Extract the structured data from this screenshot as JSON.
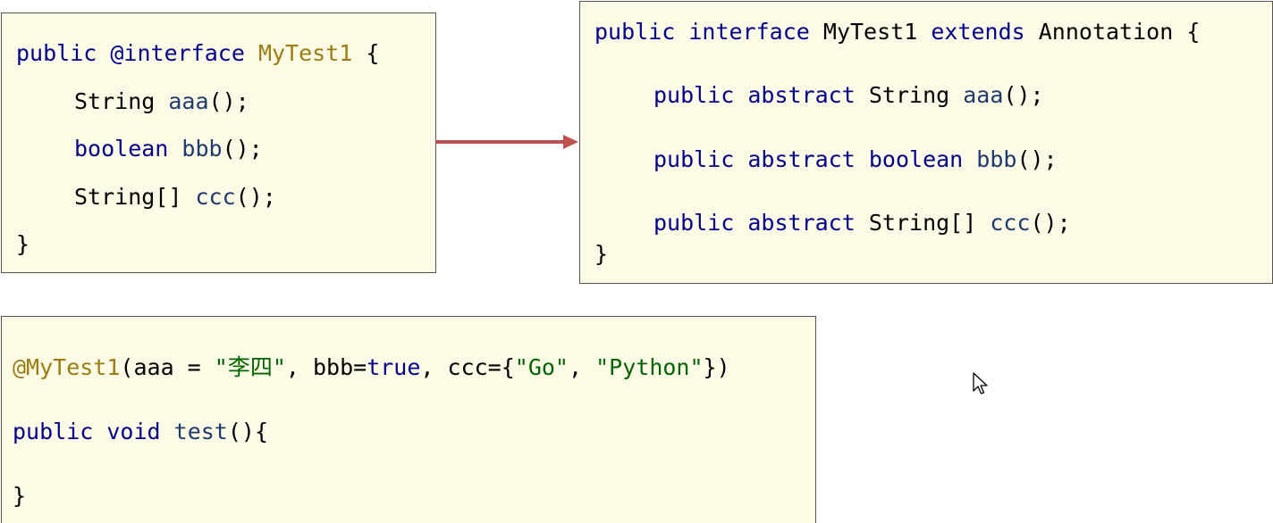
{
  "annotation_box": {
    "line1": {
      "kw_public": "public",
      "kw_interface": "@interface",
      "name": "MyTest1",
      "brace": " {"
    },
    "line2": {
      "type": "String",
      "method": "aaa",
      "tail": "();"
    },
    "line3": {
      "kw_type": "boolean",
      "method": "bbb",
      "tail": "();"
    },
    "line4": {
      "type": "String[]",
      "method": "ccc",
      "tail": "();"
    },
    "line5": {
      "brace": "}"
    }
  },
  "interface_box": {
    "line1": {
      "kw_public": "public",
      "kw_interface": "interface",
      "name": "MyTest1",
      "kw_extends": "extends",
      "parent": "Annotation",
      "brace": " {"
    },
    "line2": {
      "kw_public": "public",
      "kw_abstract": "abstract",
      "type": "String",
      "method": "aaa",
      "tail": "();"
    },
    "line3": {
      "kw_public": "public",
      "kw_abstract": "abstract",
      "kw_type": "boolean",
      "method": "bbb",
      "tail": "();"
    },
    "line4": {
      "kw_public": "public",
      "kw_abstract": "abstract",
      "type": "String[]",
      "method": "ccc",
      "tail": "();"
    },
    "line5": {
      "brace": "}"
    }
  },
  "usage_box": {
    "line1": {
      "annotation": "@MyTest1",
      "p1": "(aaa = ",
      "s1": "\"李四\"",
      "p2": ", bbb=",
      "kw_true": "true",
      "p3": ", ccc={",
      "s2": "\"Go\"",
      "p4": ", ",
      "s3": "\"Python\"",
      "p5": "})"
    },
    "line2": {
      "kw_public": "public",
      "kw_void": "void",
      "method": "test",
      "tail": "(){"
    },
    "line3": {
      "brace": "}"
    }
  },
  "colors": {
    "box_background": "#fdfbe5",
    "box_border": "#555555",
    "keyword": "#00008b",
    "annotation_name": "#9b7c13",
    "method_name": "#1e3a6e",
    "string_literal": "#006400",
    "arrow": "#c0504d"
  },
  "icons": {
    "arrow": "right-arrow-icon",
    "cursor": "mouse-cursor-icon"
  }
}
